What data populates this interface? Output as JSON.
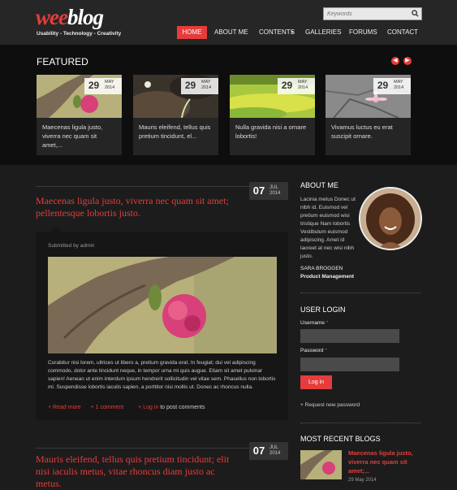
{
  "site": {
    "logo_part1": "wee",
    "logo_part2": "blog",
    "tagline": "Usability - Technology - Creativity"
  },
  "search": {
    "placeholder": "Keywords"
  },
  "nav": [
    {
      "label": "HOME",
      "active": true
    },
    {
      "label": "ABOUT ME"
    },
    {
      "label": "CONTENTS"
    },
    {
      "label": "GALLERIES"
    },
    {
      "label": "FORUMS"
    },
    {
      "label": "CONTACT"
    }
  ],
  "featured": {
    "heading": "FEATURED",
    "cards": [
      {
        "day": "29",
        "month": "MAY",
        "year": "2014",
        "caption": "Maecenas ligula justo, viverra nec quam sit amet,..."
      },
      {
        "day": "29",
        "month": "MAY",
        "year": "2014",
        "caption": "Mauris eleifend, tellus quis pretium tincidunt, el..."
      },
      {
        "day": "29",
        "month": "MAY",
        "year": "2014",
        "caption": "Nulla gravida nisi a ornare lobortis!"
      },
      {
        "day": "29",
        "month": "MAY",
        "year": "2014",
        "caption": "Vivamus luctus eu erat suscipit ornare."
      }
    ]
  },
  "posts": [
    {
      "title": "Maecenas ligula justo, viverra nec quam sit amet; pellentesque lobortis justo.",
      "day": "07",
      "month": "JUL",
      "year": "2014",
      "submitted": "Submitted by admin",
      "body": "Curabitur nisi lorem, ultrices ut libero a, pretium gravida erat. In feugiat; dui vel adipiscing commodo, dolor ante tincidunt neque, in tempor urna mi quis augue. Etiam sit amet pulvinar sapien! Aenean ut enim interdum ipsum hendrerit sollicitudin vel vitae sem. Phasellus non lobortis mi. Suspendisse lobortis iaculis sapien, a porttitor nisi mollis ut. Donec ac rhoncus nulla.",
      "read_more": "+ Read more",
      "comment": "+ 1 comment",
      "login": "+ Log in",
      "login_suffix": " to post comments"
    },
    {
      "title": "Mauris eleifend, tellus quis pretium tincidunt; elit nisi iaculis metus, vitae rhoncus diam justo ac metus.",
      "day": "07",
      "month": "JUL",
      "year": "2014"
    }
  ],
  "about": {
    "heading": "ABOUT ME",
    "text": "Lacinia metus Donec ut nibh id. Euismod vel pretium euismod wisi tristique Nam lobortis Vestibulum euismod adipiscing. Amet id laoreet at nec wisi nibh justo.",
    "name": "SARA BROGGEN",
    "role": "Product Management"
  },
  "login": {
    "heading": "USER LOGIN",
    "username_label": "Username",
    "password_label": "Password",
    "required_mark": "*",
    "button": "Log in",
    "new_password": "+ Request new password"
  },
  "recent": {
    "heading": "MOST RECENT BLOGS",
    "title": "Maecenas ligula justo, viverra nec quam sit amet;...",
    "date": "29 May 2014"
  },
  "colors": {
    "accent": "#e63c3c",
    "background": "#1e1e1e"
  }
}
